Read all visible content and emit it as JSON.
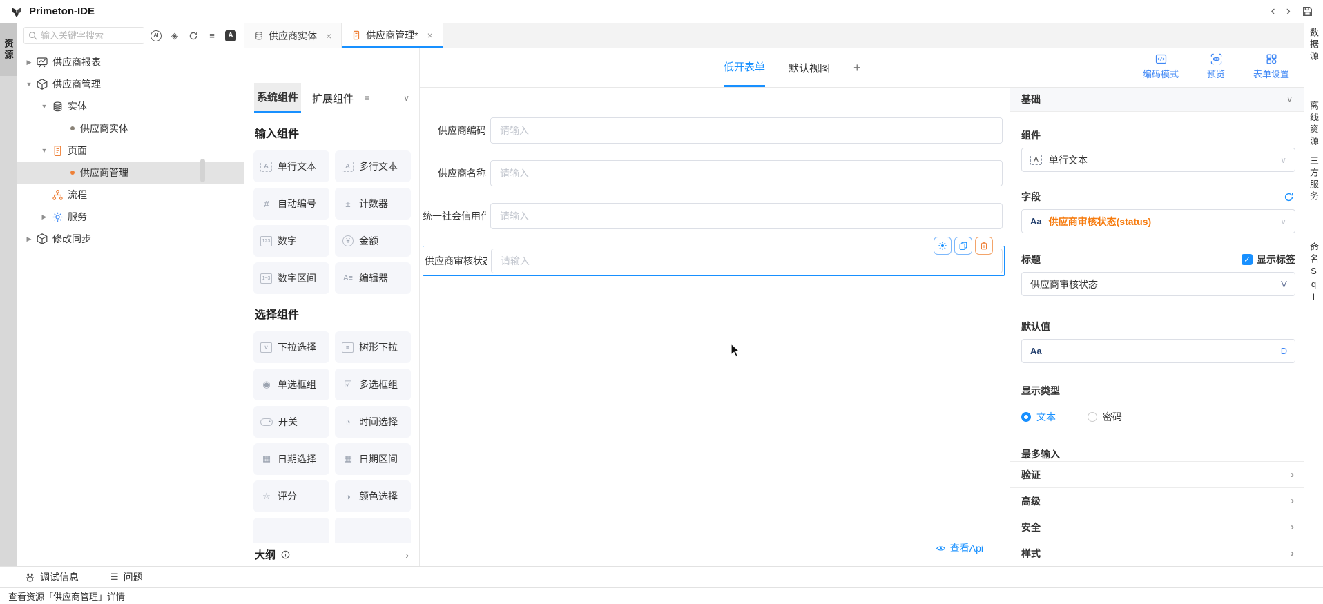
{
  "titlebar": {
    "title": "Primeton-IDE"
  },
  "glyphs": {
    "back": "‹",
    "forward": "›",
    "close": "×",
    "chevron_down": "∨",
    "chevron_right": "›",
    "tree_collapsed": "▶",
    "tree_expanded": "▼",
    "hamburger": "≡",
    "outline_edit": "≡",
    "ai": "AI",
    "model": "◈",
    "translate": "A",
    "issues": "☰"
  },
  "activity_bar": {
    "items": [
      {
        "label": "资源",
        "active": true
      }
    ]
  },
  "sidebar": {
    "search": {
      "placeholder": "输入关键字搜索"
    },
    "tree": [
      {
        "label": "供应商报表"
      },
      {
        "label": "供应商管理"
      },
      {
        "label": "实体"
      },
      {
        "label": "供应商实体"
      },
      {
        "label": "页面"
      },
      {
        "label": "供应商管理",
        "selected": true
      },
      {
        "label": "流程"
      },
      {
        "label": "服务"
      },
      {
        "label": "修改同步"
      }
    ]
  },
  "editor_tabs": [
    {
      "label": "供应商实体"
    },
    {
      "label": "供应商管理*",
      "active": true
    }
  ],
  "canvas": {
    "view_tabs": [
      {
        "label": "低开表单",
        "active": true
      },
      {
        "label": "默认视图"
      },
      {
        "label": "+"
      }
    ],
    "actions": [
      {
        "label": "编码模式"
      },
      {
        "label": "预览"
      },
      {
        "label": "表单设置"
      }
    ],
    "fields": [
      {
        "label": "供应商编码",
        "placeholder": "请输入"
      },
      {
        "label": "供应商名称",
        "placeholder": "请输入"
      },
      {
        "label": "统一社会信用代",
        "placeholder": "请输入"
      },
      {
        "label": "供应商审核状态",
        "placeholder": "请输入",
        "selected": true
      }
    ],
    "view_api_label": "查看Api"
  },
  "palette": {
    "tabs": [
      {
        "label": "系统组件",
        "active": true
      },
      {
        "label": "扩展组件"
      }
    ],
    "sections": [
      {
        "title": "输入组件",
        "items": [
          {
            "label": "单行文本",
            "glyph": "A"
          },
          {
            "label": "多行文本",
            "glyph": "A"
          },
          {
            "label": "自动编号",
            "glyph": "#"
          },
          {
            "label": "计数器",
            "glyph": "±"
          },
          {
            "label": "数字",
            "glyph": "123"
          },
          {
            "label": "金额",
            "glyph": "¥"
          },
          {
            "label": "数字区间",
            "glyph": "1~3"
          },
          {
            "label": "编辑器",
            "glyph": "A≡"
          }
        ]
      },
      {
        "title": "选择组件",
        "items": [
          {
            "label": "下拉选择",
            "glyph": "∨"
          },
          {
            "label": "树形下拉",
            "glyph": "≡"
          },
          {
            "label": "单选框组",
            "glyph": "◉"
          },
          {
            "label": "多选框组",
            "glyph": "☑"
          },
          {
            "label": "开关",
            "glyph": "●"
          },
          {
            "label": "时间选择",
            "glyph": "◔"
          },
          {
            "label": "日期选择",
            "glyph": "▦"
          },
          {
            "label": "日期区间",
            "glyph": "▦"
          },
          {
            "label": "评分",
            "glyph": "☆"
          },
          {
            "label": "颜色选择",
            "glyph": "◑"
          }
        ]
      }
    ],
    "outline": {
      "label": "大纲"
    }
  },
  "properties": {
    "header": "基础",
    "component": {
      "label": "组件",
      "icon_glyph": "A",
      "value": "单行文本"
    },
    "field": {
      "label": "字段",
      "icon_glyph": "Aa",
      "value": "供应商审核状态(status)"
    },
    "title": {
      "label": "标题",
      "checkbox_label": "显示标签",
      "check_glyph": "✓",
      "value": "供应商审核状态",
      "suffix": "V"
    },
    "default_value": {
      "label": "默认值",
      "glyph": "Aa",
      "suffix": "D"
    },
    "display_type": {
      "label": "显示类型",
      "options": [
        {
          "label": "文本",
          "selected": true
        },
        {
          "label": "密码"
        }
      ]
    },
    "max_input": {
      "label": "最多输入"
    },
    "sections": [
      {
        "label": "验证"
      },
      {
        "label": "高级"
      },
      {
        "label": "安全"
      },
      {
        "label": "样式"
      }
    ]
  },
  "right_bar": {
    "items": [
      {
        "label": "数据源"
      },
      {
        "label": "离线资源"
      },
      {
        "label": "三方服务"
      },
      {
        "label": "命名Sql"
      }
    ]
  },
  "bottom_bar": {
    "items": [
      {
        "label": "调试信息"
      },
      {
        "label": "问题"
      }
    ]
  },
  "status_bar": {
    "text": "查看资源「供应商管理」详情"
  },
  "colors": {
    "accent": "#1890ff",
    "orange": "#ee8139",
    "field_value_orange": "#f67b0e"
  }
}
